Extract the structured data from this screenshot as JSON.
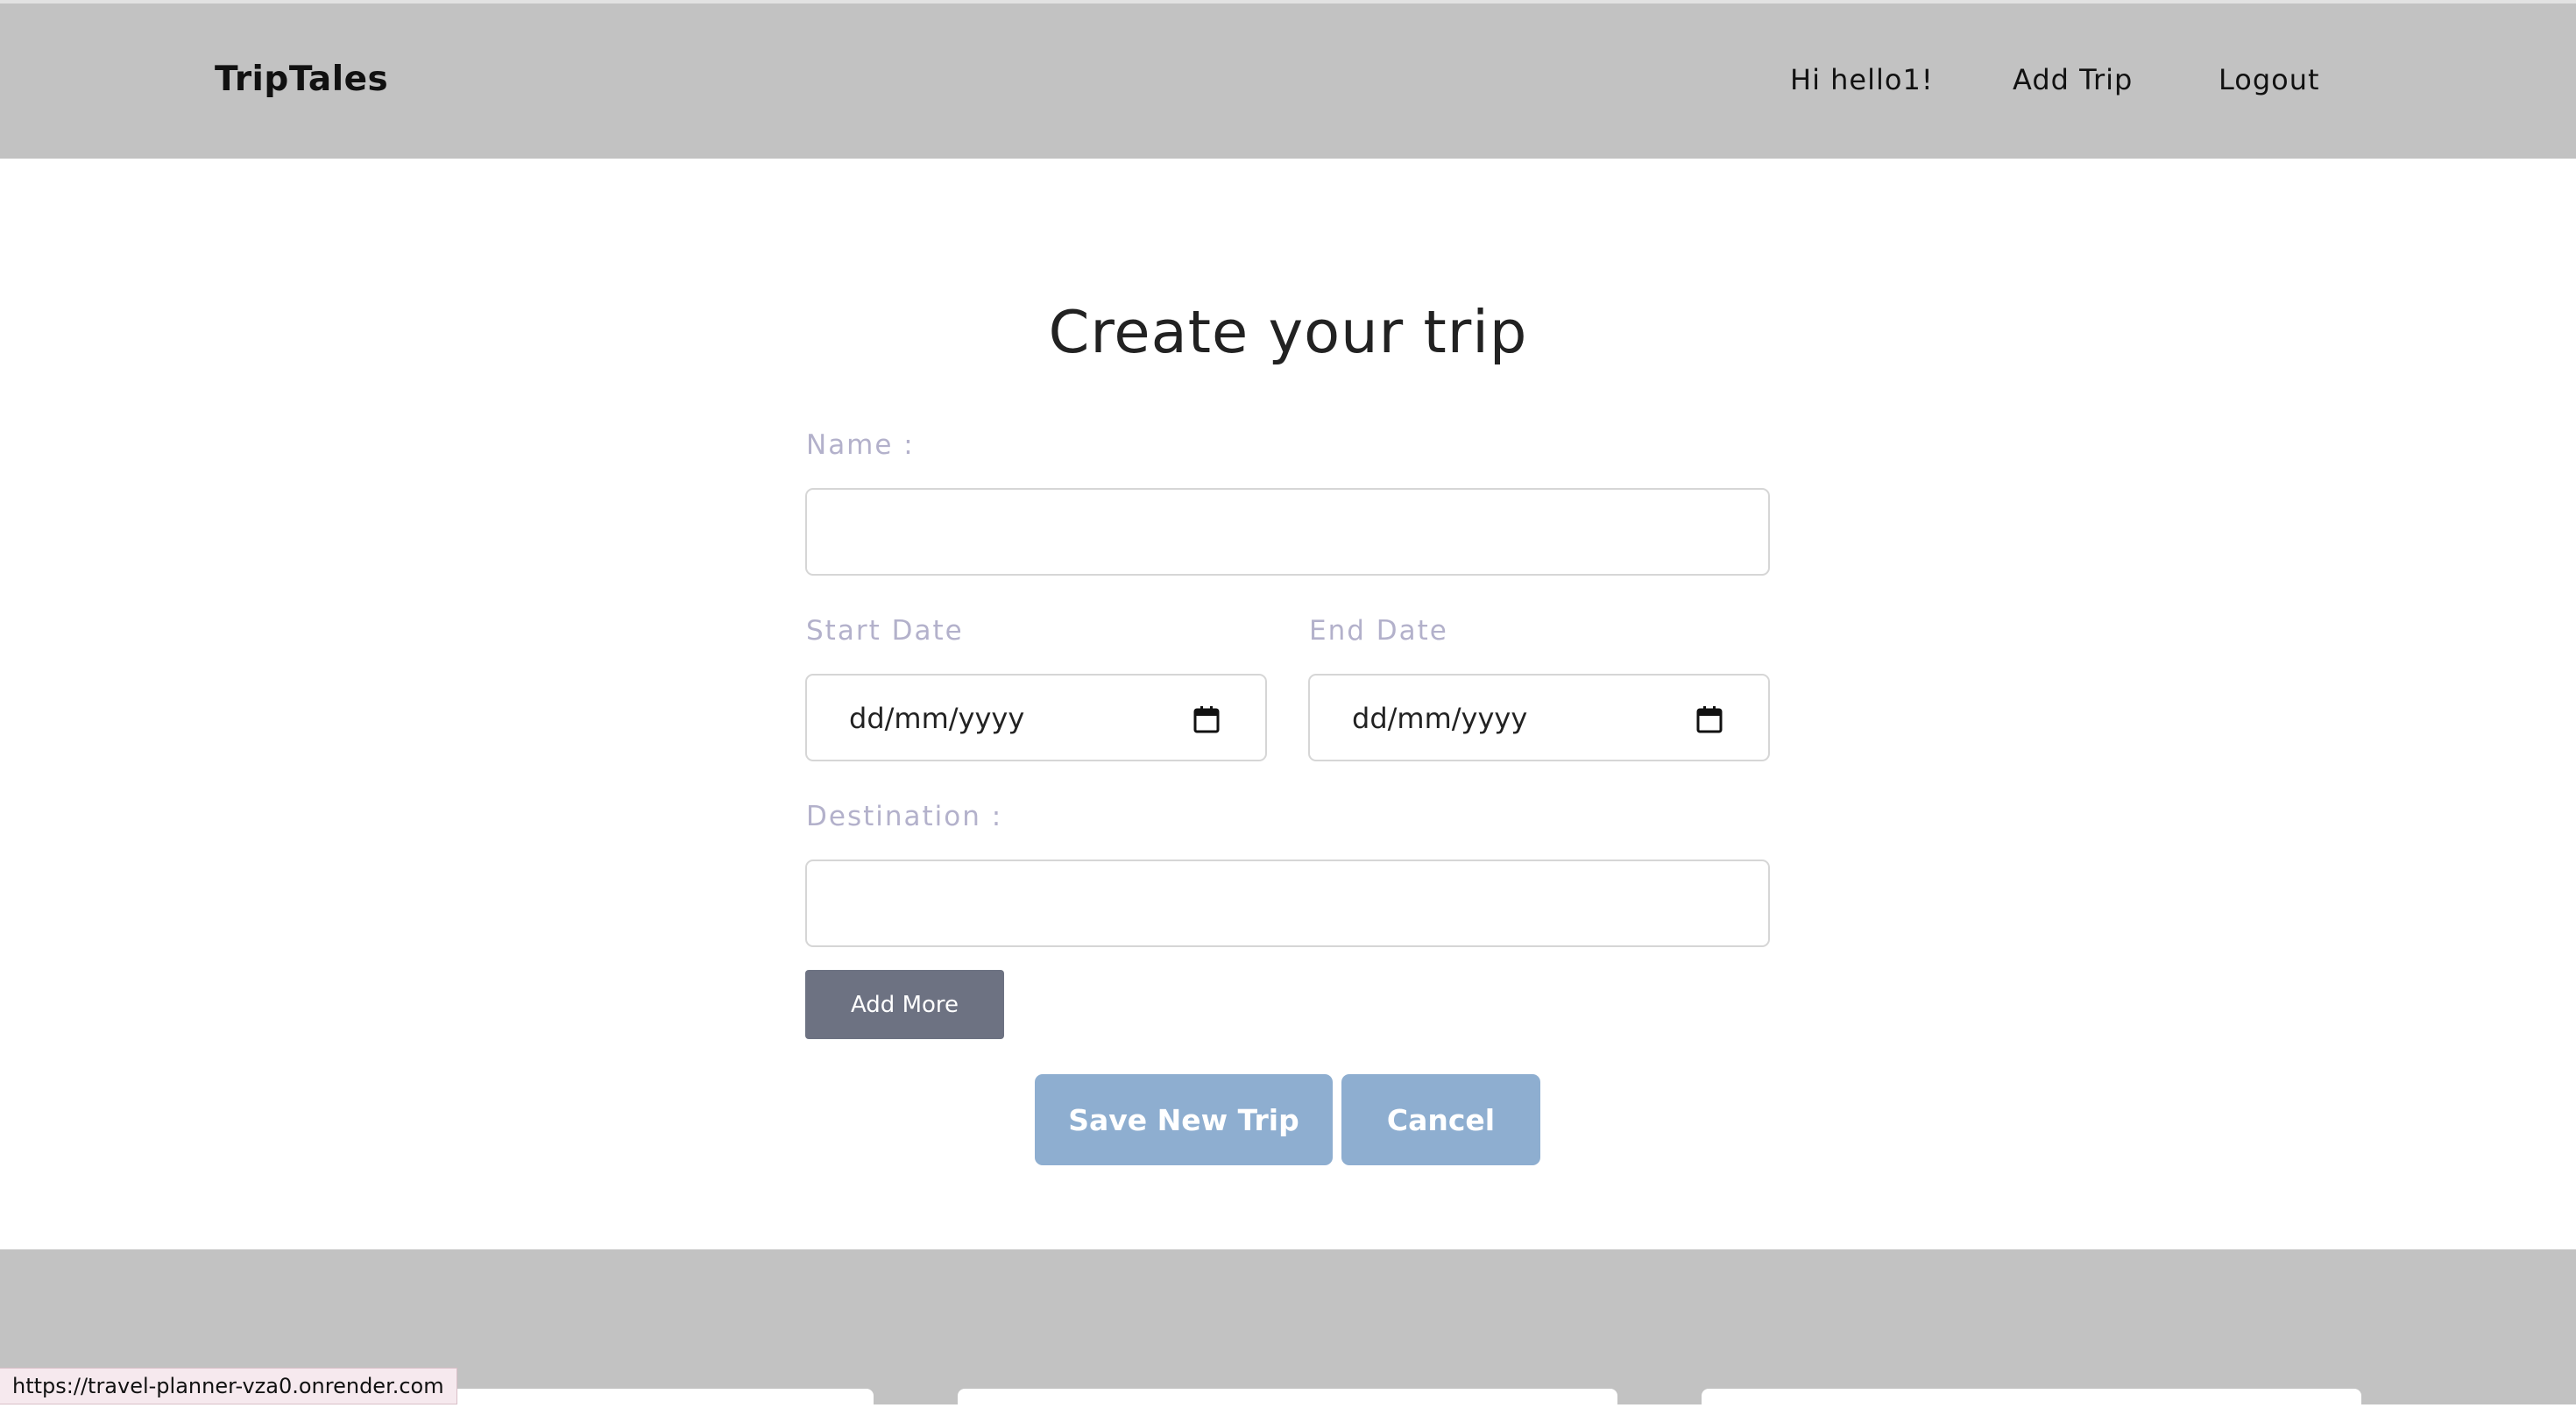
{
  "navbar": {
    "brand": "TripTales",
    "greeting": "Hi hello1!",
    "add_trip": "Add Trip",
    "logout": "Logout"
  },
  "form": {
    "title": "Create your trip",
    "name_label": "Name :",
    "name_value": "",
    "start_date_label": "Start Date",
    "start_date_placeholder": "dd/mm/yyyy",
    "end_date_label": "End Date",
    "end_date_placeholder": "dd/mm/yyyy",
    "destination_label": "Destination :",
    "destination_value": "",
    "add_more": "Add More",
    "save": "Save New Trip",
    "cancel": "Cancel"
  },
  "status_bar": {
    "url": "https://travel-planner-vza0.onrender.com"
  },
  "colors": {
    "header_bg": "#c2c2c2",
    "label": "#b3b1cb",
    "primary_button": "#8eaed0",
    "secondary_button": "#6d7282"
  }
}
